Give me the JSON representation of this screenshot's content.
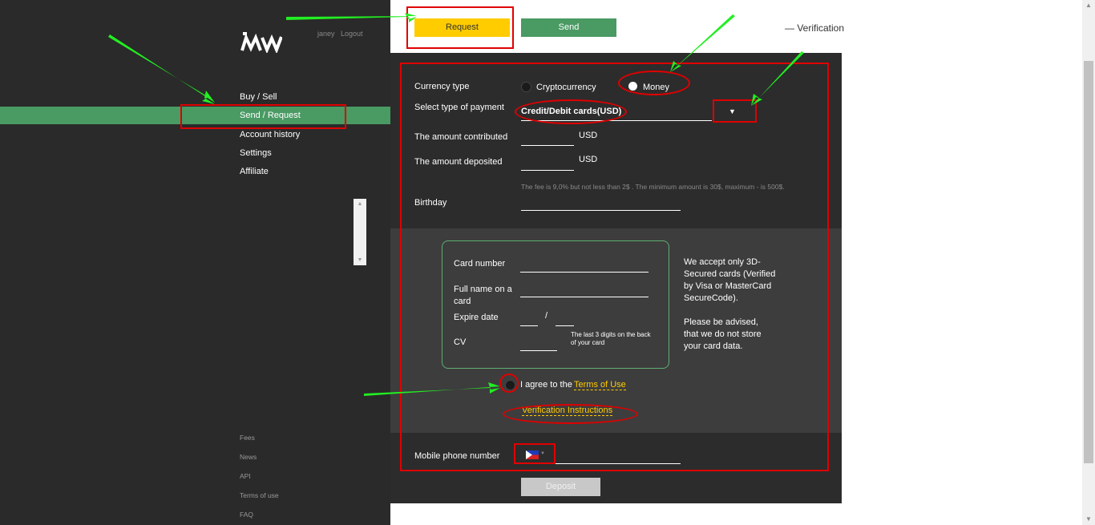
{
  "user": {
    "name": "janey",
    "logout": "Logout"
  },
  "nav": [
    "Buy / Sell",
    "Send / Request",
    "Account history",
    "Settings",
    "Affiliate"
  ],
  "footer_links": [
    "Fees",
    "News",
    "API",
    "Terms of use",
    "FAQ"
  ],
  "tabs": {
    "request": "Request",
    "send": "Send"
  },
  "verification_title": "— Verification",
  "form": {
    "currency_type_label": "Currency type",
    "currency_options": [
      "Cryptocurrency",
      "Money"
    ],
    "currency_selected": "Money",
    "payment_type_label": "Select type of payment",
    "payment_type_value": "Credit/Debit cards(USD)",
    "amount_contributed_label": "The amount contributed",
    "amount_deposited_label": "The amount deposited",
    "currency_unit": "USD",
    "fee_note": "The fee is 9,0% but not less than 2$ . The minimum amount is 30$, maximum - is 500$.",
    "birthday_label": "Birthday"
  },
  "card": {
    "number_label": "Card number",
    "fullname_label": "Full name on a card",
    "expire_label": "Expire date",
    "expire_sep": "/",
    "cv_label": "CV",
    "cv_hint": "The last 3 digits on the back of your card",
    "note1": "We accept only 3D-Secured cards (Verified by Visa or MasterCard SecureCode).",
    "note2": "Please be advised, that we do not store your card data."
  },
  "agree_text": "I agree to the",
  "terms_link": "Terms of Use",
  "verification_instructions": "Verification Instructions",
  "mobile_label": "Mobile phone number",
  "deposit_button": "Deposit",
  "colors": {
    "accent_yellow": "#ffcc00",
    "accent_green": "#4a9a63",
    "annotation_red": "#e00000",
    "annotation_arrow": "#22ee22"
  }
}
